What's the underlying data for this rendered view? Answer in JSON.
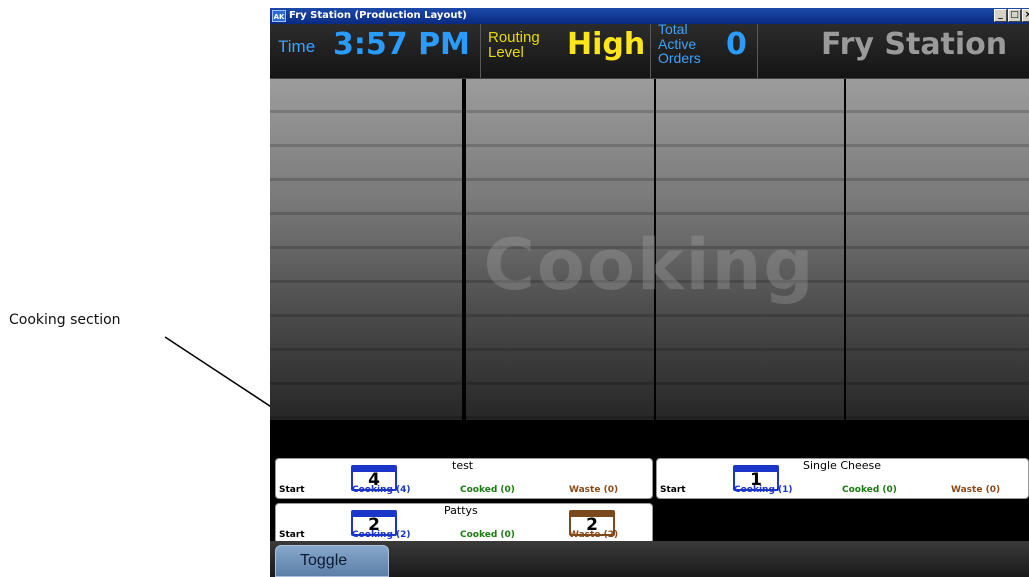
{
  "annotation": {
    "label": "Cooking section"
  },
  "window": {
    "icon_text": "AK",
    "title": "Fry Station (Production Layout)",
    "buttons": [
      "_",
      "□",
      "×"
    ]
  },
  "header": {
    "time_label": "Time",
    "time_value": "3:57 PM",
    "routing_label": "Routing Level",
    "routing_value": "High",
    "orders_label": "Total Active Orders",
    "orders_value": "0",
    "station_name": "Fry Station"
  },
  "cooking": {
    "watermark": "Cooking"
  },
  "cards": [
    {
      "title": "test",
      "start": "Start",
      "counter": "4",
      "cooking": "Cooking (4)",
      "cooked": "Cooked (0)",
      "waste": "Waste (0)"
    },
    {
      "title": "Single Cheese",
      "start": "Start",
      "counter": "1",
      "cooking": "Cooking (1)",
      "cooked": "Cooked (0)",
      "waste": "Waste (0)"
    },
    {
      "title": "Pattys",
      "start": "Start",
      "counter": "2",
      "cooking": "Cooking (2)",
      "cooked": "Cooked (0)",
      "waste_counter": "2",
      "waste": "Waste (2)"
    }
  ],
  "footer": {
    "toggle_label": "Toggle"
  },
  "colors": {
    "accent_blue": "#2a9bff",
    "routing_yellow": "#ffe51a",
    "cooked_green": "#1c7a12",
    "waste_brown": "#8a4a1a"
  }
}
